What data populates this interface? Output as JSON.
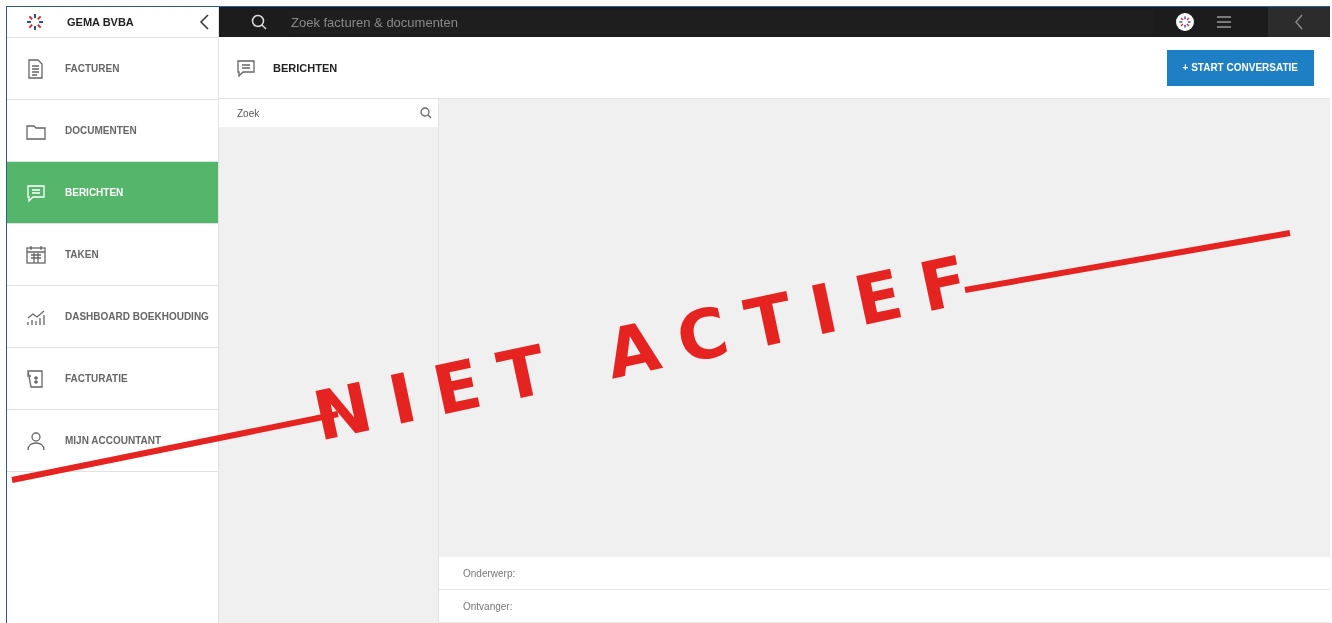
{
  "sidebar": {
    "company": "GEMA BVBA",
    "items": [
      {
        "label": "FACTUREN",
        "selected": false
      },
      {
        "label": "DOCUMENTEN",
        "selected": false
      },
      {
        "label": "BERICHTEN",
        "selected": true
      },
      {
        "label": "TAKEN",
        "selected": false
      },
      {
        "label": "DASHBOARD BOEKHOUDING",
        "selected": false
      },
      {
        "label": "FACTURATIE",
        "selected": false
      },
      {
        "label": "MIJN ACCOUNTANT",
        "selected": false
      }
    ]
  },
  "topbar": {
    "search_placeholder": "Zoek facturen & documenten"
  },
  "header": {
    "title": "BERICHTEN",
    "button": "+ START CONVERSATIE"
  },
  "conversations": {
    "search_placeholder": "Zoek"
  },
  "compose": {
    "fields": [
      "Onderwerp:",
      "Ontvanger:"
    ]
  },
  "stamp": {
    "text": "NIET ACTIEF"
  }
}
